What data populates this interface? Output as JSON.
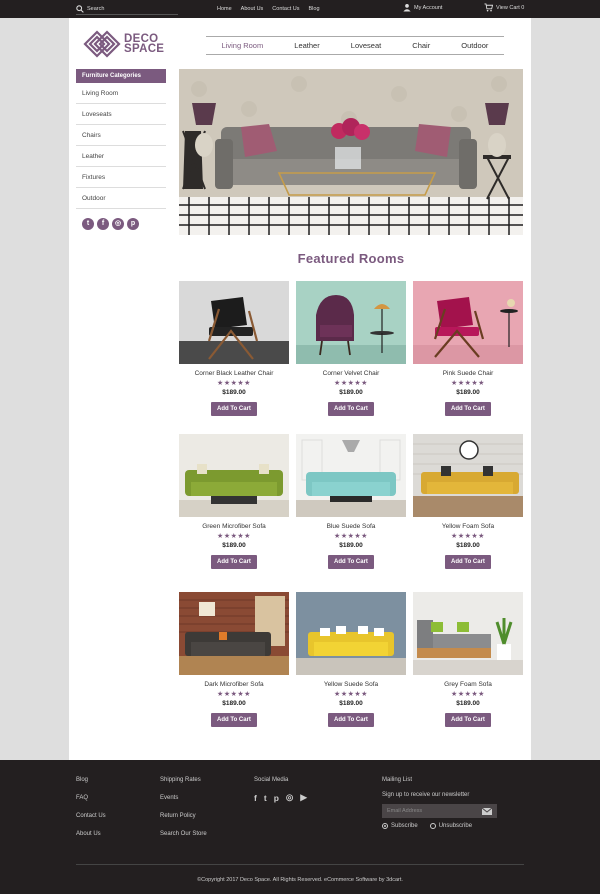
{
  "topbar": {
    "search_placeholder": "Search",
    "nav": [
      "Home",
      "About Us",
      "Contact Us",
      "Blog"
    ],
    "account": "My Account",
    "cart": "View Cart 0"
  },
  "logo": {
    "line1": "DECO",
    "line2": "SPACE"
  },
  "mainnav": [
    "Living Room",
    "Leather",
    "Loveseat",
    "Chair",
    "Outdoor"
  ],
  "sidebar": {
    "title": "Furniture Categories",
    "items": [
      "Living Room",
      "Loveseats",
      "Chairs",
      "Leather",
      "Fixtures",
      "Outdoor"
    ],
    "social": [
      "twitter-icon",
      "facebook-icon",
      "instagram-icon",
      "pinterest-icon"
    ]
  },
  "featured": {
    "title": "Featured Rooms"
  },
  "products": [
    {
      "name": "Corner Black Leather Chair",
      "rating": 5,
      "stars": "★★★★★",
      "price": "$189.00",
      "button": "Add To Cart"
    },
    {
      "name": "Corner Velvet Chair",
      "rating": 5,
      "stars": "★★★★★",
      "price": "$189.00",
      "button": "Add To Cart"
    },
    {
      "name": "Pink Suede Chair",
      "rating": 5,
      "stars": "★★★★★",
      "price": "$189.00",
      "button": "Add To Cart"
    },
    {
      "name": "Green Microfiber Sofa",
      "rating": 5,
      "stars": "★★★★★",
      "price": "$189.00",
      "button": "Add To Cart"
    },
    {
      "name": "Blue Suede Sofa",
      "rating": 5,
      "stars": "★★★★★",
      "price": "$189.00",
      "button": "Add To Cart"
    },
    {
      "name": "Yellow Foam Sofa",
      "rating": 5,
      "stars": "★★★★★",
      "price": "$189.00",
      "button": "Add To Cart"
    },
    {
      "name": "Dark Microfiber Sofa",
      "rating": 5,
      "stars": "★★★★★",
      "price": "$189.00",
      "button": "Add To Cart"
    },
    {
      "name": "Yellow Suede Sofa",
      "rating": 5,
      "stars": "★★★★★",
      "price": "$189.00",
      "button": "Add To Cart"
    },
    {
      "name": "Grey Foam Sofa",
      "rating": 5,
      "stars": "★★★★★",
      "price": "$189.00",
      "button": "Add To Cart"
    }
  ],
  "footer": {
    "col1": [
      "Blog",
      "FAQ",
      "Contact Us",
      "About Us"
    ],
    "col2": [
      "Shipping Rates",
      "Events",
      "Return Policy",
      "Search Our Store"
    ],
    "social_title": "Social Media",
    "social": [
      "facebook-icon",
      "twitter-icon",
      "pinterest-icon",
      "instagram-icon",
      "youtube-icon"
    ],
    "mailing_title": "Mailing List",
    "mailing_sub": "Sign up to receive our newsletter",
    "email_placeholder": "Email Address",
    "subscribe": "Subscribe",
    "unsubscribe": "Unsubscribe",
    "copyright": "©Copyright 2017 Deco Space. All Rights Reserved. eCommerce Software by 3dcart."
  },
  "colors": {
    "accent": "#7b5a7f",
    "dark": "#231f20",
    "page_bg": "#dedede"
  }
}
